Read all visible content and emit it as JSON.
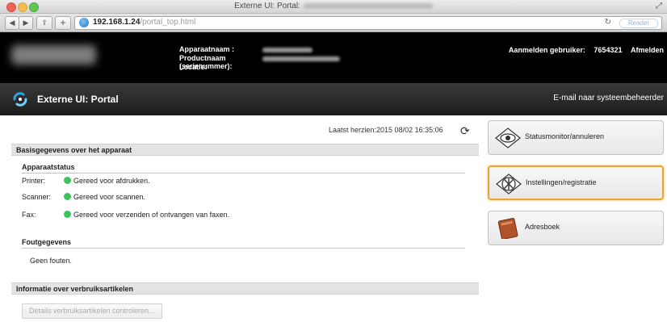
{
  "window": {
    "title": "Externe UI: Portal:"
  },
  "toolbar": {
    "url_host": "192.168.1.24",
    "url_path": "/portal_top.html",
    "reader_label": "Reader"
  },
  "header": {
    "device_name_label": "Apparaatnaam :",
    "product_name_label": "Productnaam (serienummer):",
    "location_label": "Locatie:",
    "login_label": "Aanmelden gebruiker:",
    "user_id": "7654321",
    "logout_label": "Afmelden"
  },
  "banner": {
    "title": "Externe UI: Portal",
    "email_link": "E-mail naar systeembeheerder"
  },
  "main": {
    "last_update": "Laatst herzien:2015 08/02 16:35:06",
    "basic_info_header": "Basisgegevens over het apparaat",
    "device_status_title": "Apparaatstatus",
    "status": [
      {
        "label": "Printer:",
        "text": "Gereed voor afdrukken."
      },
      {
        "label": "Scanner:",
        "text": "Gereed voor scannen."
      },
      {
        "label": "Fax:",
        "text": "Gereed voor verzenden of ontvangen van faxen."
      }
    ],
    "error_title": "Foutgegevens",
    "error_text": "Geen fouten.",
    "consumables_header": "Informatie over verbruiksartikelen",
    "details_button": "Details verbruiksartikelen controleren..."
  },
  "side": {
    "status_monitor": "Statusmonitor/annuleren",
    "settings": "Instellingen/registratie",
    "address_book": "Adresboek"
  },
  "colors": {
    "status_ok": "#3cc35a",
    "highlight": "#efa232",
    "banner": "#1c1c1c"
  }
}
